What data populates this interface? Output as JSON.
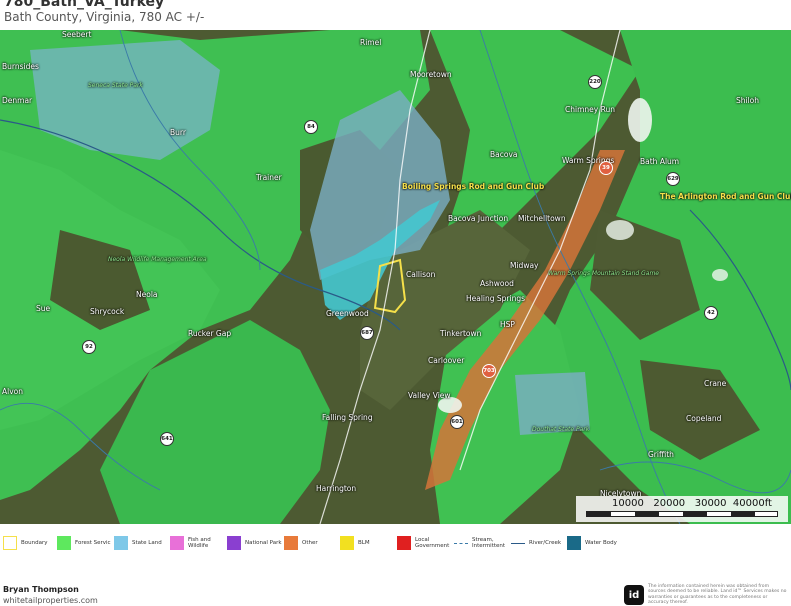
{
  "header": {
    "title": "780_Bath_VA_Turkey",
    "subtitle": "Bath County, Virginia, 780 AC +/-"
  },
  "map": {
    "towns": [
      "Seebert",
      "Burnsides",
      "Denmar",
      "Burr",
      "Rimel",
      "Mooretown",
      "Chimney Run",
      "Bacova",
      "Warm Springs",
      "Bath Alum",
      "Trainer",
      "Bacova Junction",
      "Mitchelltown",
      "Callison",
      "Ashwood",
      "Midway",
      "Healing Springs",
      "Neola",
      "Shrycock",
      "Rucker Gap",
      "Greenwood",
      "Tinkertown",
      "Carloover",
      "Valley View",
      "Falling Spring",
      "Harrington",
      "Alvon",
      "Sue",
      "Crane",
      "Copeland",
      "Griffith",
      "Nicelytown",
      "Shiloh",
      "Millboro Springs",
      "White Sulphur Springs"
    ],
    "clubs": [
      "Boiling Springs Rod and Gun Club",
      "The Arlington Rod and Gun Club"
    ],
    "areas": [
      "Seneca State Park",
      "Neola Wildlife Management Area",
      "Douthat State Park",
      "Warm Springs Mountain Stand Game",
      "Fort"
    ],
    "features": [
      "Big Run",
      "Brushy Run",
      "HSP"
    ],
    "routes": [
      "220",
      "39",
      "84",
      "92",
      "600",
      "687",
      "603",
      "703",
      "629",
      "42",
      "641",
      "689",
      "601"
    ]
  },
  "scale": {
    "labels": [
      "10000",
      "20000",
      "30000",
      "40000ft"
    ]
  },
  "legend": {
    "items": [
      {
        "label": "Boundary",
        "color": "#f5e04a",
        "kind": "outline"
      },
      {
        "label": "Forest Servic",
        "color": "#5ee85e",
        "kind": "fill"
      },
      {
        "label": "State Land",
        "color": "#7ec8e8",
        "kind": "fill"
      },
      {
        "label": "Fish and Wildlife",
        "color": "#e870d8",
        "kind": "fill"
      },
      {
        "label": "National Park",
        "color": "#8a3fd0",
        "kind": "fill"
      },
      {
        "label": "Other",
        "color": "#e87a3a",
        "kind": "fill"
      },
      {
        "label": "BLM",
        "color": "#f2e020",
        "kind": "fill"
      },
      {
        "label": "Local Government",
        "color": "#e02020",
        "kind": "fill"
      },
      {
        "label": "Stream, Intermittent",
        "color": "#3a7aa8",
        "kind": "dash"
      },
      {
        "label": "River/Creek",
        "color": "#2a5a88",
        "kind": "line"
      },
      {
        "label": "Water Body",
        "color": "#1a6a88",
        "kind": "fill"
      }
    ]
  },
  "footer": {
    "author": "Bryan Thompson",
    "site": "whitetailproperties.com",
    "logo": "id",
    "disclaimer": "The information contained herein was obtained from sources deemed to be reliable. Land id™ Services makes no warranties or guarantees as to the completeness or accuracy thereof."
  }
}
